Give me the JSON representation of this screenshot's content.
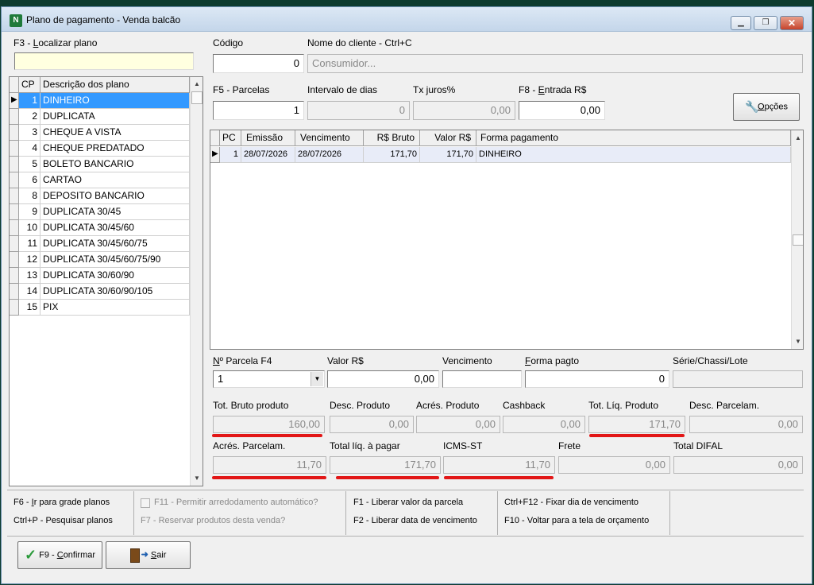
{
  "window": {
    "title": "Plano de pagamento - Venda balcão"
  },
  "search": {
    "label_prefix": "F3 - ",
    "label_key": "L",
    "label_rest": "ocalizar plano",
    "value": ""
  },
  "plans": {
    "headers": [
      "CP",
      "Descrição dos plano"
    ],
    "rows": [
      {
        "cp": "1",
        "desc": "DINHEIRO"
      },
      {
        "cp": "2",
        "desc": "DUPLICATA"
      },
      {
        "cp": "3",
        "desc": "CHEQUE A VISTA"
      },
      {
        "cp": "4",
        "desc": "CHEQUE PREDATADO"
      },
      {
        "cp": "5",
        "desc": "BOLETO BANCARIO"
      },
      {
        "cp": "6",
        "desc": "CARTAO"
      },
      {
        "cp": "8",
        "desc": "DEPOSITO BANCARIO"
      },
      {
        "cp": "9",
        "desc": "DUPLICATA 30/45"
      },
      {
        "cp": "10",
        "desc": "DUPLICATA 30/45/60"
      },
      {
        "cp": "11",
        "desc": "DUPLICATA 30/45/60/75"
      },
      {
        "cp": "12",
        "desc": "DUPLICATA 30/45/60/75/90"
      },
      {
        "cp": "13",
        "desc": "DUPLICATA 30/60/90"
      },
      {
        "cp": "14",
        "desc": "DUPLICATA 30/60/90/105"
      },
      {
        "cp": "15",
        "desc": "PIX"
      }
    ],
    "selected_index": 0
  },
  "codigo": {
    "label": "Código",
    "value": "0"
  },
  "cliente": {
    "label": "Nome do cliente - Ctrl+C",
    "placeholder": "Consumidor..."
  },
  "parcelas": {
    "label": "F5 - Parcelas",
    "value": "1"
  },
  "intervalo": {
    "label": "Intervalo de dias",
    "value": "0"
  },
  "juros": {
    "label": "Tx juros%",
    "value": "0,00"
  },
  "entrada": {
    "label_prefix": "F8 - ",
    "label_key": "E",
    "label_rest": "ntrada R$",
    "value": "0,00"
  },
  "opcoes_button": {
    "label_key": "O",
    "label_rest": "pções",
    "icon": "wrench-icon"
  },
  "installments": {
    "headers": [
      "PC",
      "Emissão",
      "Vencimento",
      "R$ Bruto",
      "Valor R$",
      "Forma pagamento"
    ],
    "rows": [
      {
        "pc": "1",
        "emissao": "28/07/2026",
        "vencimento": "28/07/2026",
        "bruto": "171,70",
        "valor": "171,70",
        "forma": "DINHEIRO"
      }
    ]
  },
  "parcela_edit": {
    "num_label_key": "N",
    "num_label_rest": "º Parcela F4",
    "num_value": "1",
    "valor_label": "Valor R$",
    "valor_value": "0,00",
    "vencimento_label": "Vencimento",
    "vencimento_value": "",
    "forma_label_key": "F",
    "forma_label_rest": "orma pagto",
    "forma_value": "0",
    "serie_label": "Série/Chassi/Lote",
    "serie_value": ""
  },
  "totals": {
    "tot_bruto": {
      "label": "Tot. Bruto produto",
      "value": "160,00"
    },
    "desc_produto": {
      "label": "Desc. Produto",
      "value": "0,00"
    },
    "acres_produto": {
      "label": "Acrés. Produto",
      "value": "0,00"
    },
    "cashback": {
      "label": "Cashback",
      "value": "0,00"
    },
    "tot_liq": {
      "label": "Tot. Líq. Produto",
      "value": "171,70"
    },
    "desc_parcelam": {
      "label": "Desc. Parcelam.",
      "value": "0,00"
    },
    "acres_parcelam": {
      "label": "Acrés. Parcelam.",
      "value": "11,70"
    },
    "total_pagar": {
      "label": "Total líq. à pagar",
      "value": "171,70"
    },
    "icms_st": {
      "label": "ICMS-ST",
      "value": "11,70"
    },
    "frete": {
      "label": "Frete",
      "value": "0,00"
    },
    "total_difal": {
      "label": "Total DIFAL",
      "value": "0,00"
    }
  },
  "shortcuts": {
    "f6_prefix": "F6 - ",
    "f6_key": "I",
    "f6_rest": "r para grade planos",
    "ctrlp": "Ctrl+P - Pesquisar planos",
    "f11": "F11 - Permitir arredodamento automático?",
    "f7": "F7 - Reservar produtos desta venda?",
    "f1": "F1 - Liberar valor da parcela",
    "f2": "F2 - Liberar data de vencimento",
    "ctrlf12": "Ctrl+F12 - Fixar dia de vencimento",
    "f10": "F10 - Voltar para a tela de orçamento"
  },
  "buttons": {
    "confirmar_prefix": "F9 - ",
    "confirmar_key": "C",
    "confirmar_rest": "onfirmar",
    "sair_key": "S",
    "sair_rest": "air"
  },
  "colors": {
    "highlight": "#3399ff",
    "row_selected": "#e8ecf8",
    "red_mark": "#e21616"
  }
}
